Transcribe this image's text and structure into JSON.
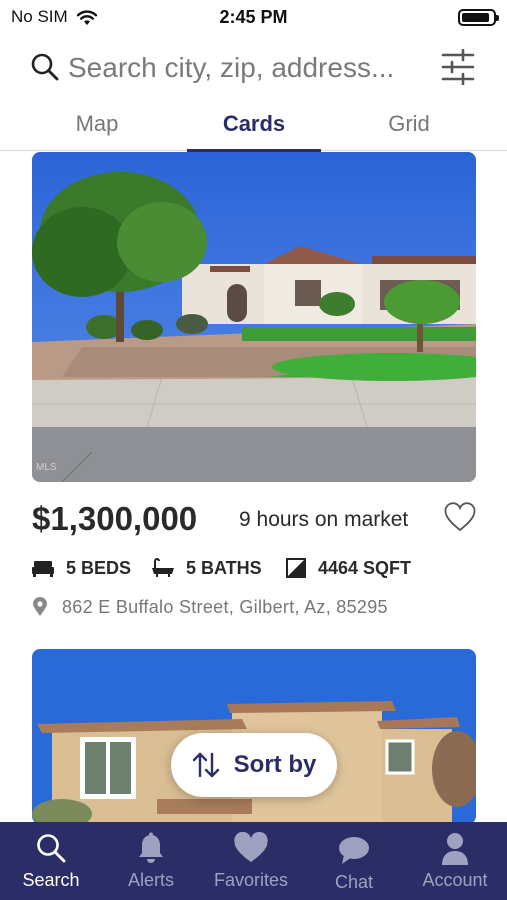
{
  "status_bar": {
    "carrier": "No SIM",
    "time": "2:45 PM"
  },
  "search": {
    "placeholder": "Search city, zip, address..."
  },
  "tabs": [
    {
      "label": "Map",
      "active": false
    },
    {
      "label": "Cards",
      "active": true
    },
    {
      "label": "Grid",
      "active": false
    }
  ],
  "listing": {
    "price": "$1,300,000",
    "time_on_market": "9 hours on market",
    "beds": "5 BEDS",
    "baths": "5 BATHS",
    "sqft": "4464 SQFT",
    "address": "862 E Buffalo Street, Gilbert, Az, 85295",
    "favorited": false
  },
  "sort_button": {
    "label": "Sort by"
  },
  "bottom_nav": [
    {
      "label": "Search",
      "icon": "search-icon",
      "active": true
    },
    {
      "label": "Alerts",
      "icon": "bell-icon",
      "active": false
    },
    {
      "label": "Favorites",
      "icon": "heart-icon",
      "active": false
    },
    {
      "label": "Chat",
      "icon": "chat-bubble-icon",
      "active": false
    },
    {
      "label": "Account",
      "icon": "person-icon",
      "active": false
    }
  ],
  "colors": {
    "brand": "#2b2e66",
    "nav_inactive": "#9ea1c0"
  }
}
